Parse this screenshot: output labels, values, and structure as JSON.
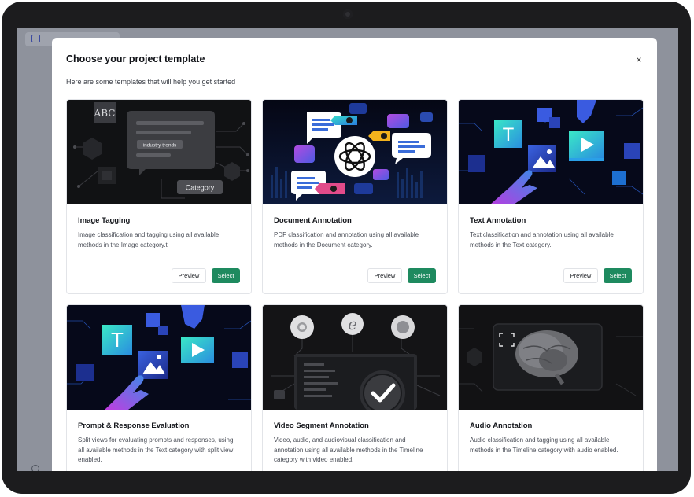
{
  "background": {
    "sidebar_item_label": "Pr",
    "accent": "#3b4aa0"
  },
  "modal": {
    "title": "Choose your project template",
    "subtitle": "Here are some templates that will help you get started",
    "close_label": "×"
  },
  "cards": [
    {
      "title": "Image Tagging",
      "description": "Image classification and tagging using all available methods in the Image category.t",
      "preview_label": "Preview",
      "select_label": "Select",
      "thumb": {
        "label_abc": "ABC",
        "label_trends": "industry trends",
        "label_category": "Category"
      }
    },
    {
      "title": "Document Annotation",
      "description": "PDF classification and annotation using all available methods in the Document category.",
      "preview_label": "Preview",
      "select_label": "Select"
    },
    {
      "title": "Text Annotation",
      "description": "Text classification and annotation using all available methods in the Text category.",
      "preview_label": "Preview",
      "select_label": "Select",
      "thumb": {
        "label_t": "T"
      }
    },
    {
      "title": "Prompt & Response Evaluation",
      "description": "Split views for evaluating prompts and responses, using all available methods in the Text category with split view enabled.",
      "thumb": {
        "label_t": "T"
      }
    },
    {
      "title": "Video Segment Annotation",
      "description": "Video, audio, and audiovisual classification and annotation using all available methods in the Timeline category with video enabled."
    },
    {
      "title": "Audio Annotation",
      "description": "Audio classification and tagging using all available methods in the Timeline category with audio enabled."
    }
  ],
  "colors": {
    "select_button": "#1e8a5f",
    "gradient_teal": "#2fd6c4",
    "gradient_blue": "#3a5bd9",
    "gradient_purple": "#8a3fd1"
  }
}
